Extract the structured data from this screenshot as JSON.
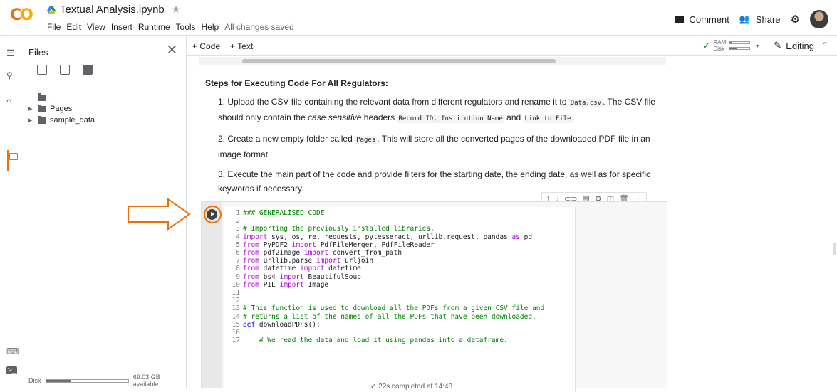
{
  "app": {
    "logo": "CO",
    "title": "Textual Analysis.ipynb",
    "menus": [
      "File",
      "Edit",
      "View",
      "Insert",
      "Runtime",
      "Tools",
      "Help"
    ],
    "save_status": "All changes saved",
    "comment_label": "Comment",
    "share_label": "Share"
  },
  "files_panel": {
    "title": "Files",
    "tree": [
      {
        "label": "..",
        "type": "parent"
      },
      {
        "label": "Pages",
        "type": "folder"
      },
      {
        "label": "sample_data",
        "type": "folder"
      }
    ],
    "disk_label": "Disk",
    "disk_available": "69.03 GB available",
    "disk_used_fraction": 0.3
  },
  "toolbar": {
    "add_code": "+ Code",
    "add_text": "+ Text",
    "ram_label": "RAM",
    "disk_label": "Disk",
    "editing_label": "Editing"
  },
  "text_cell": {
    "heading": "Steps for Executing Code For All Regulators:",
    "steps": [
      {
        "n": "1.",
        "a": "Upload the CSV file containing the relevant data from different regulators and rename it to ",
        "code1": "Data.csv",
        "b": ". The CSV file should only contain the ",
        "em": "case sensitive",
        "c": " headers ",
        "code2": "Record ID, Institution Name",
        "d": " and ",
        "code3": "Link to File",
        "e": "."
      },
      {
        "n": "2.",
        "a": "Create a new empty folder called ",
        "code1": "Pages",
        "b": ". This will store all the converted pages of the downloaded PDF file in an image format."
      },
      {
        "n": "3.",
        "a": "Execute the main part of the code and provide filters for the starting date, the ending date, as well as for specific keywords if necessary."
      }
    ]
  },
  "code_lines": [
    "### GENERALISED CODE",
    "",
    "# Importing the previously installed libraries.",
    "import sys, os, re, requests, pytesseract, urllib.request, pandas as pd",
    "from PyPDF2 import PdfFileMerger, PdfFileReader",
    "from pdf2image import convert_from_path",
    "from urllib.parse import urljoin",
    "from datetime import datetime",
    "from bs4 import BeautifulSoup",
    "from PIL import Image",
    "",
    "",
    "# This function is used to download all the PDFs from a given CSV file and",
    "# returns a list of the names of all the PDFs that have been downloaded.",
    "def downloadPDFs():",
    "",
    "    # We read the data and load it using pandas into a dataframe."
  ],
  "status_text": "✓ 22s   completed at 14:48",
  "colors": {
    "accent": "#e8710a",
    "logo_yellow": "#f9ab00",
    "green": "#1e8e3e"
  }
}
